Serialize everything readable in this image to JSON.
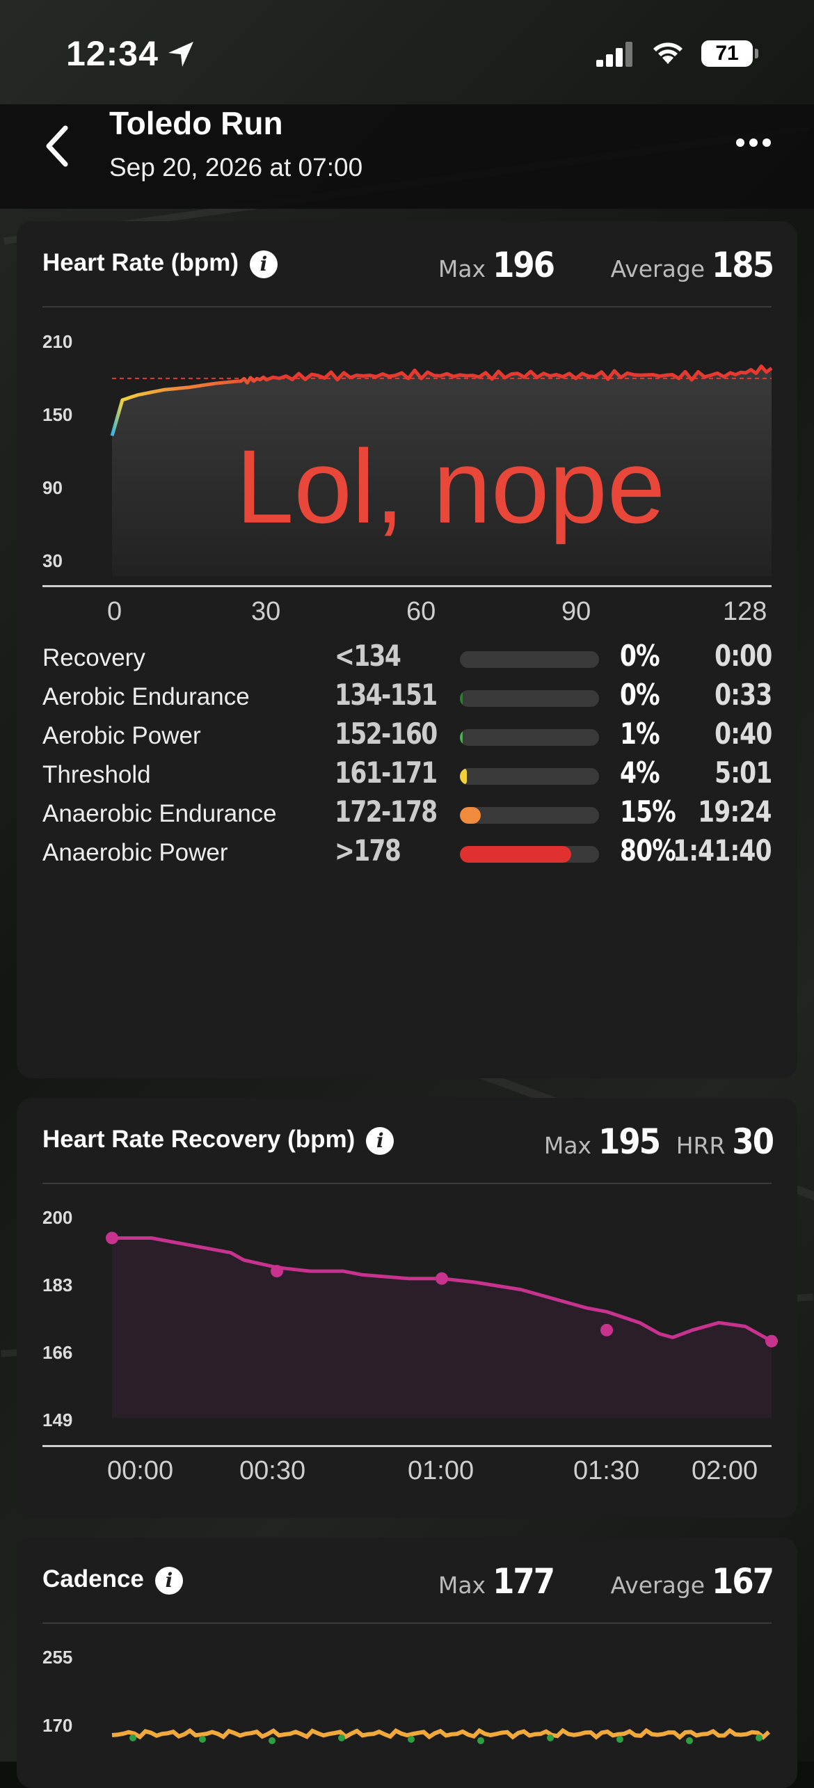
{
  "status_bar": {
    "time": "12:34",
    "battery": "71"
  },
  "header": {
    "title": "Toledo Run",
    "subtitle": "Sep 20, 2026 at 07:00"
  },
  "heart_rate": {
    "title": "Heart Rate (bpm)",
    "max_label": "Max",
    "max_value": "196",
    "avg_label": "Average",
    "avg_value": "185",
    "overlay_text": "Lol, nope",
    "y_ticks": [
      "210",
      "150",
      "90",
      "30"
    ],
    "x_ticks": [
      "0",
      "30",
      "60",
      "90",
      "128"
    ],
    "zones": [
      {
        "name": "Recovery",
        "range": "<134",
        "percent": "0%",
        "duration": "0:00",
        "fill": 0.0,
        "color": "#3a3a3a"
      },
      {
        "name": "Aerobic Endurance",
        "range": "134-151",
        "percent": "0%",
        "duration": "0:33",
        "fill": 0.02,
        "color": "#2e7d32"
      },
      {
        "name": "Aerobic Power",
        "range": "152-160",
        "percent": "1%",
        "duration": "0:40",
        "fill": 0.02,
        "color": "#4caf50"
      },
      {
        "name": "Threshold",
        "range": "161-171",
        "percent": "4%",
        "duration": "5:01",
        "fill": 0.05,
        "color": "#f2d03b"
      },
      {
        "name": "Anaerobic Endurance",
        "range": "172-178",
        "percent": "15%",
        "duration": "19:24",
        "fill": 0.15,
        "color": "#f08a3c"
      },
      {
        "name": "Anaerobic Power",
        "range": ">178",
        "percent": "80%",
        "duration": "1:41:40",
        "fill": 0.8,
        "color": "#e03030"
      }
    ]
  },
  "hr_recovery": {
    "title": "Heart Rate Recovery (bpm)",
    "max_label": "Max",
    "max_value": "195",
    "hrr_label": "HRR",
    "hrr_value": "30",
    "y_ticks": [
      "200",
      "183",
      "166",
      "149"
    ],
    "x_ticks": [
      "00:00",
      "00:30",
      "01:00",
      "01:30",
      "02:00"
    ]
  },
  "cadence": {
    "title": "Cadence",
    "max_label": "Max",
    "max_value": "177",
    "avg_label": "Average",
    "avg_value": "167",
    "y_ticks": [
      "255",
      "170"
    ]
  },
  "chart_data": [
    {
      "type": "line",
      "title": "Heart Rate (bpm)",
      "x": [
        0,
        2,
        5,
        10,
        15,
        20,
        25,
        30,
        40,
        50,
        60,
        70,
        80,
        90,
        100,
        110,
        120,
        128
      ],
      "series": [
        {
          "values": [
            140,
            168,
            172,
            176,
            178,
            181,
            183,
            185,
            187,
            187,
            188,
            187,
            188,
            187,
            188,
            187,
            188,
            193
          ]
        }
      ],
      "ylim": [
        30,
        210
      ],
      "xlim": [
        0,
        128
      ],
      "reference_line": 185
    },
    {
      "type": "line",
      "title": "Heart Rate Recovery (bpm)",
      "x": [
        "00:00",
        "00:30",
        "01:00",
        "01:30",
        "02:00"
      ],
      "series": [
        {
          "values": [
            195,
            186,
            184,
            170,
            167
          ]
        }
      ],
      "ylim": [
        149,
        200
      ]
    },
    {
      "type": "scatter",
      "title": "Cadence",
      "series": [
        {
          "values": [
            167,
            168,
            166,
            167,
            169,
            167,
            166,
            168,
            167,
            167
          ]
        }
      ],
      "ylim": [
        170,
        255
      ]
    }
  ]
}
